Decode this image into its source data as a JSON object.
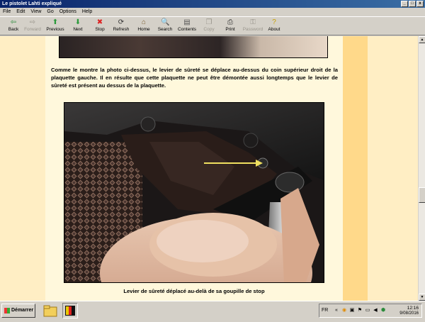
{
  "window": {
    "title": "Le pistolet Lahti expliqué",
    "title_buttons": [
      "_",
      "□",
      "x"
    ]
  },
  "menu": [
    "File",
    "Edit",
    "View",
    "Go",
    "Options",
    "Help"
  ],
  "toolbar": [
    {
      "label": "Back",
      "icon": "back-arrow-icon",
      "glyph": "⇦",
      "color": "#2a8a3a",
      "enabled": true
    },
    {
      "label": "Forward",
      "icon": "forward-arrow-icon",
      "glyph": "⇨",
      "color": "#9a968d",
      "enabled": false
    },
    {
      "label": "Previous",
      "icon": "up-arrow-icon",
      "glyph": "⬆",
      "color": "#2a9a3a",
      "enabled": true
    },
    {
      "label": "Next",
      "icon": "down-arrow-icon",
      "glyph": "⬇",
      "color": "#2a9a3a",
      "enabled": true
    },
    {
      "label": "Stop",
      "icon": "stop-icon",
      "glyph": "✖",
      "color": "#d22",
      "enabled": true
    },
    {
      "label": "Refresh",
      "icon": "refresh-icon",
      "glyph": "⟳",
      "color": "#333",
      "enabled": true
    },
    {
      "label": "Home",
      "icon": "home-icon",
      "glyph": "⌂",
      "color": "#7a5a2a",
      "enabled": true
    },
    {
      "label": "Search",
      "icon": "search-icon",
      "glyph": "🔍",
      "color": "#333",
      "enabled": true
    },
    {
      "label": "Contents",
      "icon": "contents-icon",
      "glyph": "▤",
      "color": "#555",
      "enabled": true
    },
    {
      "label": "Copy",
      "icon": "copy-icon",
      "glyph": "❐",
      "color": "#9a968d",
      "enabled": false
    },
    {
      "label": "Print",
      "icon": "print-icon",
      "glyph": "⎙",
      "color": "#333",
      "enabled": true
    },
    {
      "label": "Password",
      "icon": "password-icon",
      "glyph": "⚿",
      "color": "#9a968d",
      "enabled": false
    },
    {
      "label": "About",
      "icon": "about-icon",
      "glyph": "?",
      "color": "#c8a000",
      "enabled": true
    }
  ],
  "content": {
    "paragraph": "Comme le montre la photo ci-dessus, le levier de sûreté se déplace au-dessus du coin supérieur droit de la plaquette gauche. Il en résulte que cette plaquette ne peut être démontée aussi longtemps que le levier de sûreté est présent au dessus de la plaquette.",
    "caption": "Levier de sûreté déplacé au-delà de sa goupille de stop"
  },
  "scrollbar": {
    "up": "▲",
    "down": "▼"
  },
  "taskbar": {
    "start_label": "Démarrer",
    "language": "FR",
    "time": "12:16",
    "date": "9/08/2016"
  },
  "colors": {
    "title_gradient_start": "#0a246a",
    "page_background": "#fff8dc",
    "side_column": "#ffd98a",
    "arrow_annotation": "#f0e060"
  }
}
